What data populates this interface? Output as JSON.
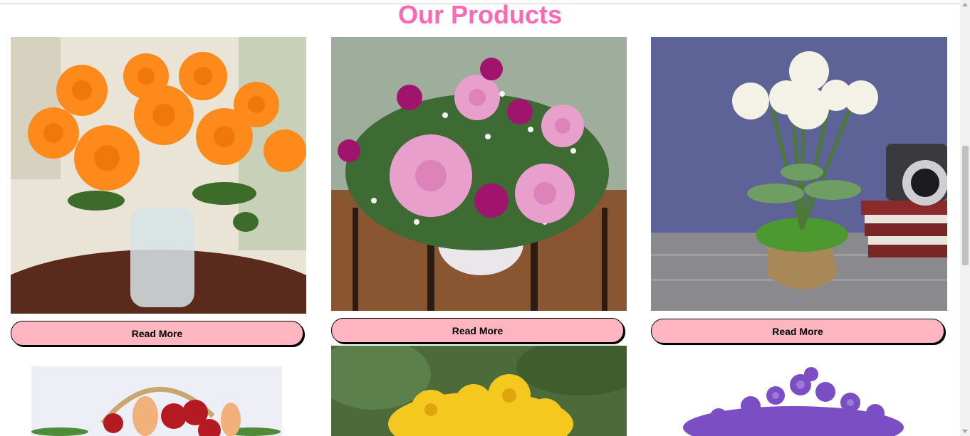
{
  "section": {
    "title": "Our Products"
  },
  "products": [
    {
      "image": "orange-roses-in-glass-vase-photo",
      "button_label": "Read More"
    },
    {
      "image": "pink-roses-bouquet-in-vase-photo",
      "button_label": "Read More"
    },
    {
      "image": "white-roses-in-moss-pot-photo",
      "button_label": "Read More"
    },
    {
      "image": "red-roses-basket-photo"
    },
    {
      "image": "yellow-sunflowers-photo"
    },
    {
      "image": "purple-bellflowers-photo"
    }
  ],
  "colors": {
    "title": "#ff69b4",
    "button_bg": "#ffb6c1"
  }
}
